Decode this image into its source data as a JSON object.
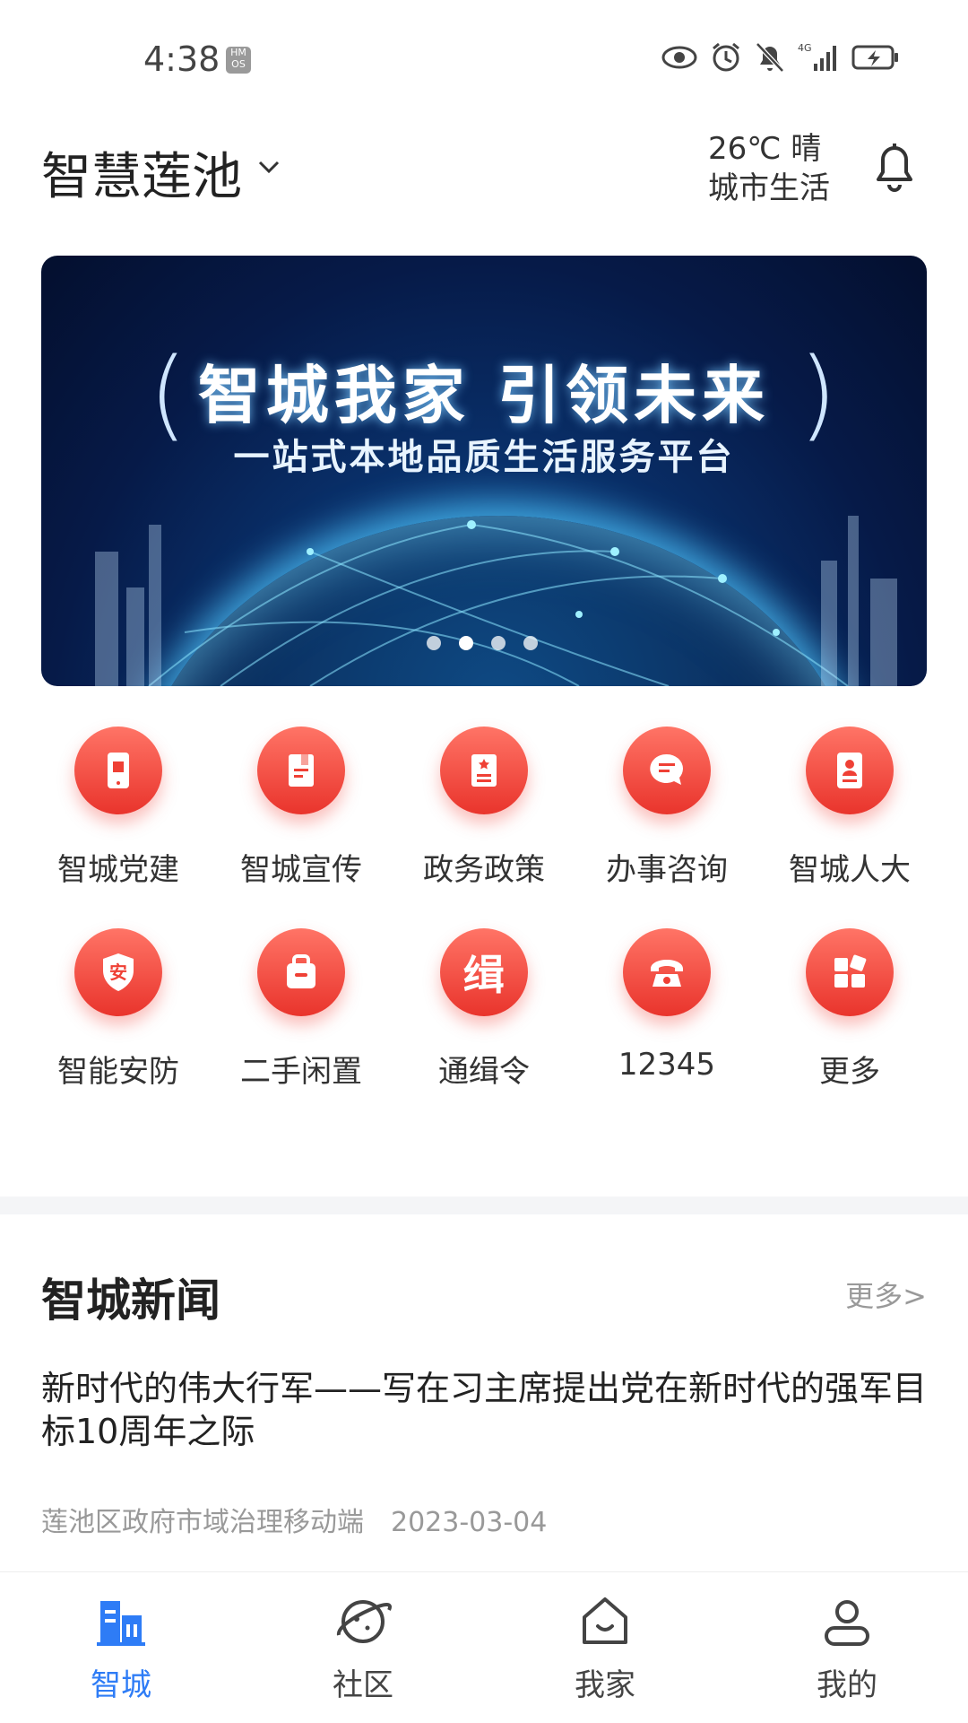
{
  "status_bar": {
    "time": "4:38",
    "hmos": "HMOS",
    "network": "4G"
  },
  "header": {
    "city": "智慧莲池",
    "temperature": "26℃ 晴",
    "subtitle": "城市生活"
  },
  "banner": {
    "title": "智城我家  引领未来",
    "subtitle": "一站式本地品质生活服务平台",
    "slides": 4,
    "active_slide": 2
  },
  "services": [
    {
      "label": "智城党建",
      "icon": "phone-party-icon"
    },
    {
      "label": "智城宣传",
      "icon": "document-icon"
    },
    {
      "label": "政务政策",
      "icon": "policy-doc-icon"
    },
    {
      "label": "办事咨询",
      "icon": "chat-bubble-icon"
    },
    {
      "label": "智城人大",
      "icon": "person-card-icon"
    },
    {
      "label": "智能安防",
      "icon": "shield-icon",
      "glyph": "安"
    },
    {
      "label": "二手闲置",
      "icon": "bag-icon"
    },
    {
      "label": "通缉令",
      "icon": "wanted-icon",
      "glyph": "缉"
    },
    {
      "label": "12345",
      "icon": "telephone-icon"
    },
    {
      "label": "更多",
      "icon": "grid-more-icon"
    }
  ],
  "news": {
    "section_title": "智城新闻",
    "more": "更多>",
    "headline": "新时代的伟大行军——写在习主席提出党在新时代的强军目标10周年之际",
    "source": "莲池区政府市域治理移动端",
    "date": "2023-03-04"
  },
  "tabs": [
    {
      "label": "智城",
      "icon": "city-buildings-icon",
      "active": true
    },
    {
      "label": "社区",
      "icon": "planet-icon",
      "active": false
    },
    {
      "label": "我家",
      "icon": "home-icon",
      "active": false
    },
    {
      "label": "我的",
      "icon": "user-icon",
      "active": false
    }
  ],
  "colors": {
    "accent": "#2e7cf6",
    "icon_red": "#ef4035",
    "muted": "#999999"
  }
}
